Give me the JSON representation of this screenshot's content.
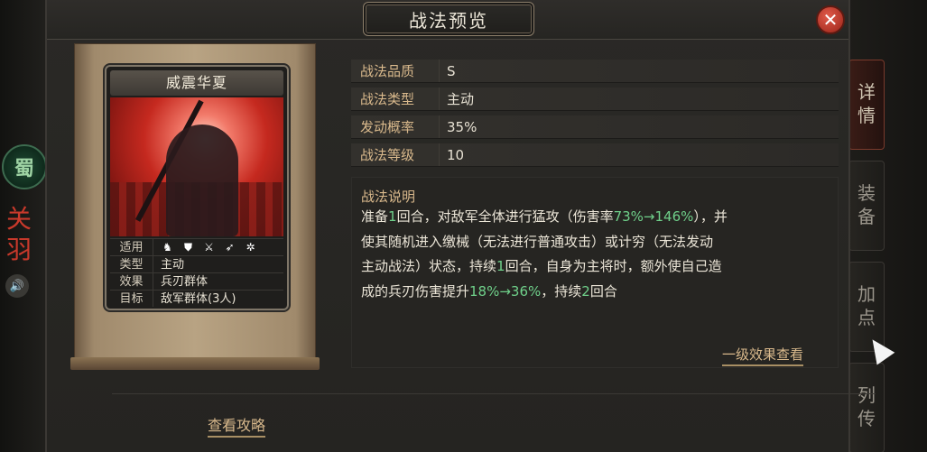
{
  "dialog": {
    "title": "战法预览",
    "close_icon": "close-icon"
  },
  "background": {
    "faction_badge": "蜀",
    "hero_name": "关羽",
    "speaker_icon": "speaker-icon",
    "side_tabs": [
      "详情",
      "装备",
      "加点",
      "列传"
    ]
  },
  "card": {
    "title": "威震华夏",
    "rows": [
      {
        "label": "适用",
        "icons": [
          "horse-cavalry-icon",
          "shield-icon",
          "crossed-swords-icon",
          "spear-icon",
          "wheel-chariot-icon"
        ]
      },
      {
        "label": "类型",
        "value": "主动"
      },
      {
        "label": "效果",
        "value": "兵刃群体"
      },
      {
        "label": "目标",
        "value": "敌军群体(3人)"
      }
    ]
  },
  "stats": [
    {
      "label": "战法品质",
      "value": "S"
    },
    {
      "label": "战法类型",
      "value": "主动"
    },
    {
      "label": "发动概率",
      "value": "35%"
    },
    {
      "label": "战法等级",
      "value": "10"
    }
  ],
  "description": {
    "title": "战法说明",
    "line1_a": "准备",
    "line1_b": "1",
    "line1_c": "回合，对敌军全体进行猛攻（伤害率",
    "line1_d": "73%→146%",
    "line1_e": "），并",
    "line2": "使其随机进入缴械（无法进行普通攻击）或计穷（无法发动",
    "line3_a": "主动战法）状态，持续",
    "line3_b": "1",
    "line3_c": "回合，自身为主将时，额外使自己造",
    "line4_a": "成的兵刃伤害提升",
    "line4_b": "18%→36%",
    "line4_c": "，持续",
    "line4_d": "2",
    "line4_e": "回合",
    "highlight_color": "#6fd08a"
  },
  "links": {
    "effect": "一级效果查看",
    "guide": "查看攻略"
  }
}
